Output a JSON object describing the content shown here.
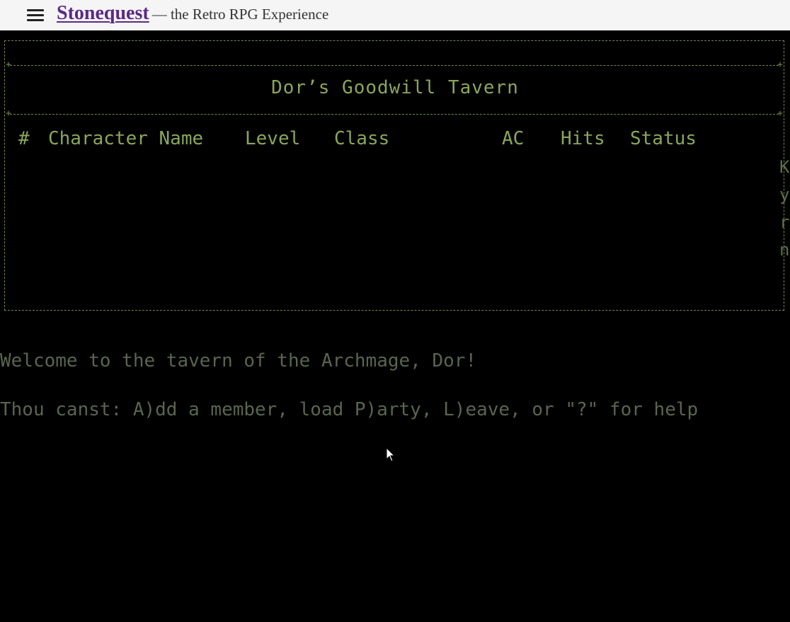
{
  "header": {
    "menu_icon": "hamburger-menu-icon",
    "site_name": "Stonequest",
    "tagline": "— the Retro RPG Experience",
    "brand_color": "#5b2a86"
  },
  "game": {
    "tavern_title": "Dor’s Goodwill Tavern",
    "columns": [
      "#",
      "Character Name",
      "Level",
      "Class",
      "AC",
      "Hits",
      "Status"
    ],
    "side_letters": [
      "K",
      "y",
      "r",
      "n"
    ],
    "messages": [
      "Welcome to the tavern of the Archmage, Dor!",
      "Thou canst: A)dd a member, load P)arty, L)eave, or \"?\" for help"
    ],
    "text_color": "#8aa65a",
    "dim_text_color": "#59654f",
    "border_color": "#6f8a4a"
  }
}
